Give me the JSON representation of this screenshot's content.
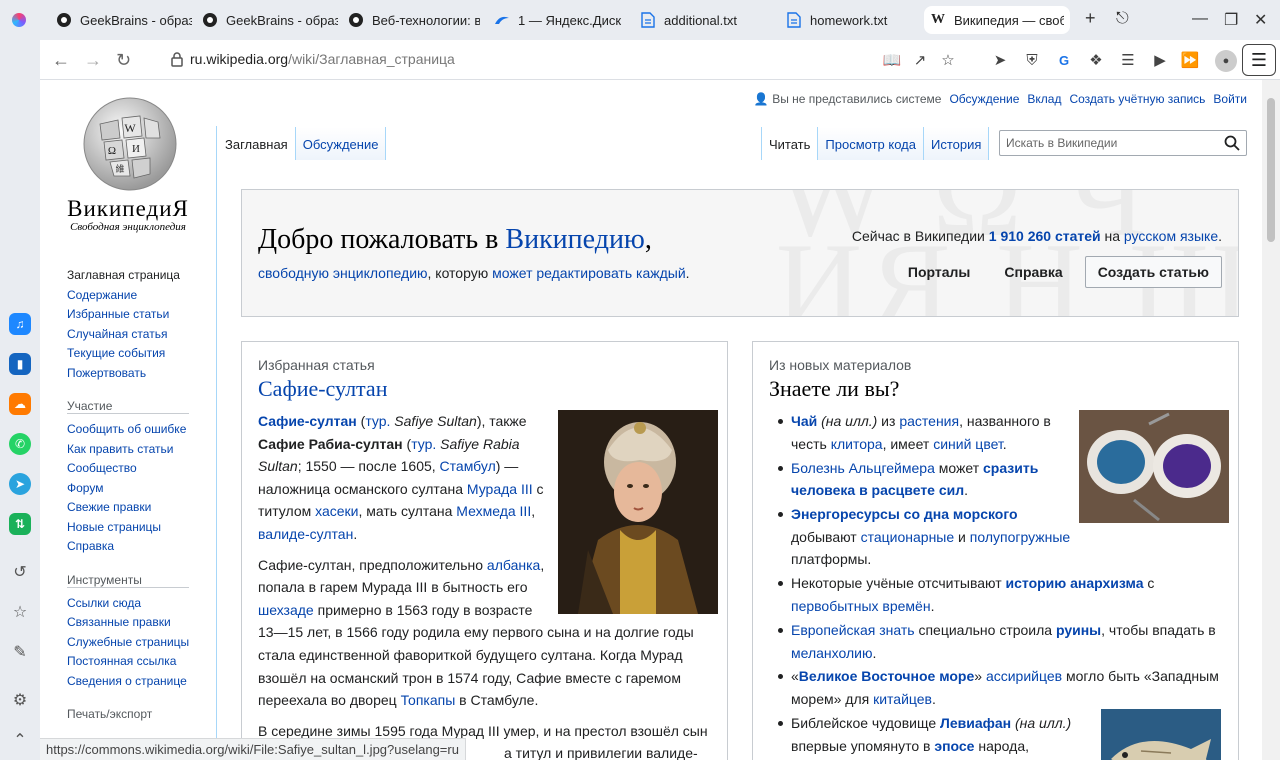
{
  "browser": {
    "tabs": [
      {
        "title": "GeekBrains - образ",
        "icon": "geekbrains-icon"
      },
      {
        "title": "GeekBrains - образ",
        "icon": "geekbrains-icon"
      },
      {
        "title": "Веб-технологии: в",
        "icon": "geekbrains-icon"
      },
      {
        "title": "1 — Яндекс.Диск",
        "icon": "yandex-disk-icon"
      },
      {
        "title": "additional.txt",
        "icon": "document-icon"
      },
      {
        "title": "homework.txt",
        "icon": "document-icon"
      },
      {
        "title": "Википедия — своб",
        "icon": "wikipedia-icon",
        "active": true
      }
    ],
    "url_host": "ru.wikipedia.org",
    "url_path": "/wiki/Заглавная_страница",
    "status_url": "https://commons.wikimedia.org/wiki/File:Safiye_sultan_l.jpg?uselang=ru"
  },
  "wiki": {
    "wordmark": "ВикипедиЯ",
    "tagline": "Свободная энциклопедия",
    "personal": {
      "anon": "Вы не представились системе",
      "talk": "Обсуждение",
      "contrib": "Вклад",
      "create_account": "Создать учётную запись",
      "login": "Войти"
    },
    "tabs_left": [
      "Заглавная",
      "Обсуждение"
    ],
    "tabs_right": [
      "Читать",
      "Просмотр кода",
      "История"
    ],
    "search_placeholder": "Искать в Википедии",
    "nav": {
      "main": [
        "Заглавная страница",
        "Содержание",
        "Избранные статьи",
        "Случайная статья",
        "Текущие события",
        "Пожертвовать"
      ],
      "participation_heading": "Участие",
      "participation": [
        "Сообщить об ошибке",
        "Как править статьи",
        "Сообщество",
        "Форум",
        "Свежие правки",
        "Новые страницы",
        "Справка"
      ],
      "tools_heading": "Инструменты",
      "tools": [
        "Ссылки сюда",
        "Связанные правки",
        "Служебные страницы",
        "Постоянная ссылка",
        "Сведения о странице"
      ],
      "print_heading": "Печать/экспорт"
    },
    "welcome": {
      "title_prefix": "Добро пожаловать в ",
      "title_link": "Википедию",
      "title_suffix": ",",
      "sub_link1": "свободную энциклопедию",
      "sub_mid": ", которую ",
      "sub_link2": "может редактировать каждый",
      "sub_end": ".",
      "stats_prefix": "Сейчас в Википедии ",
      "stats_count": "1 910 260 статей",
      "stats_mid": " на ",
      "stats_lang": "русском языке",
      "stats_end": ".",
      "portals": "Порталы",
      "help": "Справка",
      "create_article": "Создать статью"
    },
    "featured": {
      "label": "Избранная статья",
      "title": "Сафие-султан",
      "p1": {
        "b1": "Сафие-султан",
        "t1": " (",
        "l1": "тур.",
        "i1": " Safiye Sultan",
        "t2": "), также ",
        "b2": "Сафие Рабиа-султан",
        "t3": " (",
        "l2": "тур.",
        "i2": " Safiye Rabia Sultan",
        "t4": "; 1550 — после 1605, ",
        "l3": "Стамбул",
        "t5": ") — наложница османского султана ",
        "l4": "Мурада III",
        "t6": " с титулом ",
        "l5": "хасеки",
        "t7": ", мать султана ",
        "l6": "Мехмеда III",
        "t8": ", ",
        "l7": "валиде-султан",
        "t9": "."
      },
      "p2": {
        "t1": "Сафие-султан, предположительно ",
        "l1": "албанка",
        "t2": ", попала в гарем Мурада III в бытность его ",
        "l2": "шехзаде",
        "t3": " примерно в 1563 году в возрасте 13—15 лет, в 1566 году родила ему первого сына и на долгие годы стала единственной фавориткой будущего султана. Когда Мурад взошёл на османский трон в 1574 году, Сафие вместе с гаремом переехала во дворец ",
        "l3": "Топкапы",
        "t4": " в Стамбуле."
      },
      "p3": {
        "t1": "В середине зимы 1595 года Мурад III умер, и на престол взошёл сын",
        "t2": "а титул и привилегии валиде-"
      }
    },
    "dyk": {
      "label": "Из новых материалов",
      "title": "Знаете ли вы?",
      "items": [
        {
          "b1": "Чай",
          "i1": " (на илл.)",
          "t1": " из ",
          "l1": "растения",
          "t2": ", названного в честь ",
          "l2": "клитора",
          "t3": ", имеет ",
          "l3": "синий цвет",
          "t4": "."
        },
        {
          "l1": "Болезнь Альцгеймера",
          "t1": " может ",
          "b1": "сразить человека в расцвете сил",
          "t2": "."
        },
        {
          "b1": "Энергоресурсы со дна морского",
          "t1": " добывают ",
          "l1": "стационарные",
          "t2": " и ",
          "l2": "полупогружные",
          "t3": " платформы."
        },
        {
          "t1": "Некоторые учёные отсчитывают ",
          "b1": "историю анархизма",
          "t2": " с ",
          "l1": "первобытных времён",
          "t3": "."
        },
        {
          "l1": "Европейская знать",
          "t1": " специально строила ",
          "b1": "руины",
          "t2": ", чтобы впадать в ",
          "l2": "меланхолию",
          "t3": "."
        },
        {
          "t1": "«",
          "b1": "Великое Восточное море",
          "t2": "» ",
          "l1": "ассирийцев",
          "t3": " могло быть «Западным морем» для ",
          "l2": "китайцев",
          "t4": "."
        },
        {
          "t1": "Библейское чудовище ",
          "b1": "Левиафан",
          "i1": " (на илл.)",
          "t2": " впервые упомянуто в ",
          "b2": "эпосе",
          "t3": " народа, жившего"
        }
      ]
    }
  },
  "colors": {
    "link": "#0645ad",
    "text": "#202122",
    "border": "#c8ccd1",
    "tab_border": "#a7d7f9"
  }
}
